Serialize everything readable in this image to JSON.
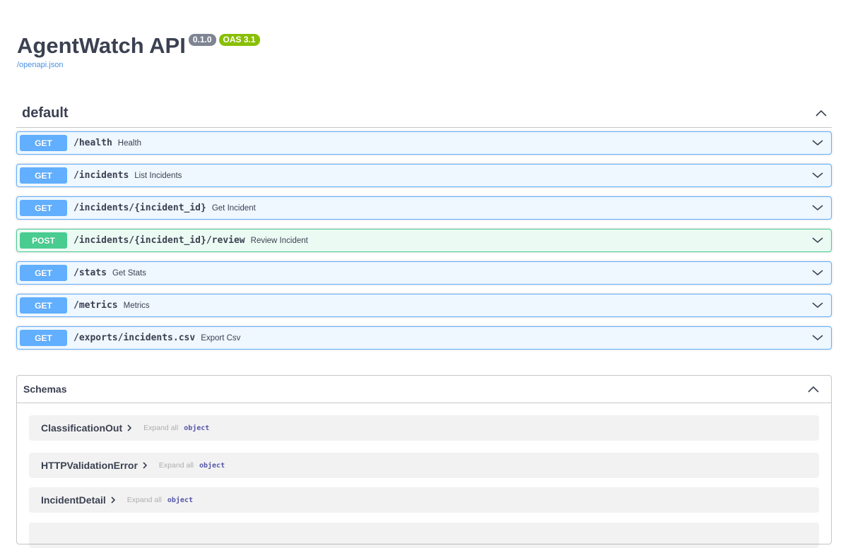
{
  "info": {
    "title": "AgentWatch API",
    "version": "0.1.0",
    "oas": "OAS 3.1",
    "spec_link": "/openapi.json"
  },
  "tag": {
    "name": "default",
    "operations": [
      {
        "method": "GET",
        "path": "/health",
        "summary": "Health"
      },
      {
        "method": "GET",
        "path": "/incidents",
        "summary": "List Incidents"
      },
      {
        "method": "GET",
        "path": "/incidents/{incident_id}",
        "summary": "Get Incident"
      },
      {
        "method": "POST",
        "path": "/incidents/{incident_id}/review",
        "summary": "Review Incident"
      },
      {
        "method": "GET",
        "path": "/stats",
        "summary": "Get Stats"
      },
      {
        "method": "GET",
        "path": "/metrics",
        "summary": "Metrics"
      },
      {
        "method": "GET",
        "path": "/exports/incidents.csv",
        "summary": "Export Csv"
      }
    ]
  },
  "schemas": {
    "title": "Schemas",
    "models": [
      {
        "name": "ClassificationOut",
        "expand": "Expand all",
        "type": "object"
      },
      {
        "name": "HTTPValidationError",
        "expand": "Expand all",
        "type": "object"
      },
      {
        "name": "IncidentDetail",
        "expand": "Expand all",
        "type": "object"
      }
    ]
  },
  "colors": {
    "get": "#61affe",
    "post": "#49cc90",
    "oas_badge": "#89bf04",
    "version_badge": "#7d8492",
    "link": "#4990e2"
  }
}
